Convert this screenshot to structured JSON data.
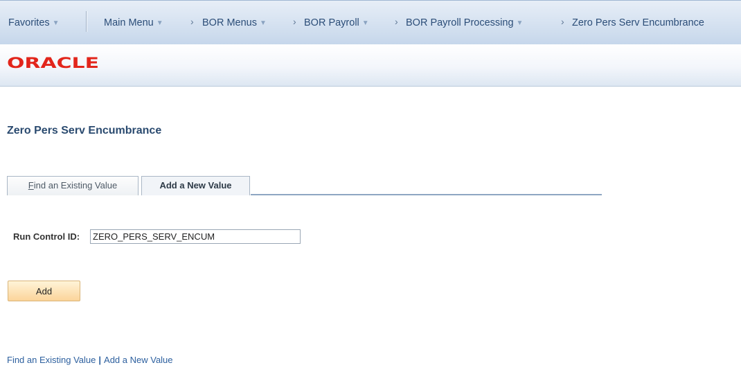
{
  "nav": {
    "favorites": "Favorites",
    "main_menu": "Main Menu",
    "separator": "›",
    "breadcrumb": [
      "BOR Menus",
      "BOR Payroll",
      "BOR Payroll Processing",
      "Zero Pers Serv Encumbrance"
    ]
  },
  "branding": {
    "logo": "ORACLE"
  },
  "page": {
    "title": "Zero Pers Serv Encumbrance"
  },
  "tabs": {
    "find_accel": "F",
    "find_rest": "ind an Existing Value",
    "add": "Add a New Value"
  },
  "form": {
    "run_control_label": "Run Control ID:",
    "run_control_value": "ZERO_PERS_SERV_ENCUM"
  },
  "actions": {
    "add_button": "Add"
  },
  "bottom_links": {
    "find": "Find an Existing Value",
    "separator": "|",
    "add": "Add a New Value"
  },
  "colors": {
    "logo": "#e2251b",
    "title": "#2a4a6f",
    "link": "#2c5f9e",
    "button_top": "#fff4d8",
    "button_bottom": "#fbd49a"
  }
}
